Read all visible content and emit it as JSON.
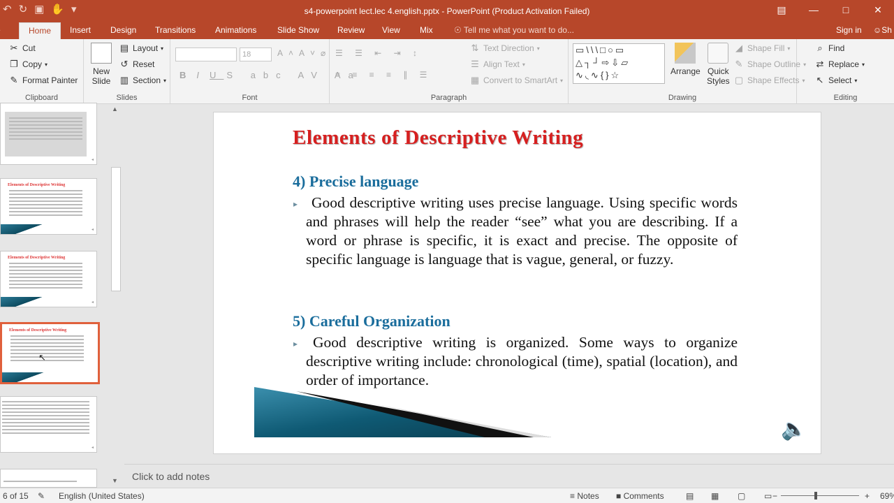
{
  "window": {
    "title": "s4-powerpoint lect.lec 4.english.pptx - PowerPoint (Product Activation Failed)",
    "qat_icons": [
      "undo-icon",
      "redo-icon",
      "present-icon",
      "touch-mode-icon",
      "customize-icon"
    ],
    "controls": [
      "ribbon-display-icon",
      "minimize-icon",
      "maximize-icon",
      "close-icon"
    ]
  },
  "tabs": [
    {
      "label": "Home",
      "active": true
    },
    {
      "label": "Insert"
    },
    {
      "label": "Design"
    },
    {
      "label": "Transitions"
    },
    {
      "label": "Animations"
    },
    {
      "label": "Slide Show"
    },
    {
      "label": "Review"
    },
    {
      "label": "View"
    },
    {
      "label": "Mix"
    }
  ],
  "tell_me": "Tell me what you want to do...",
  "sign_in": "Sign in",
  "share": "Sh",
  "ribbon": {
    "clipboard": {
      "label": "Clipboard",
      "cut": "Cut",
      "copy": "Copy",
      "format_painter": "Format Painter"
    },
    "slides": {
      "label": "Slides",
      "new_slide_1": "New",
      "new_slide_2": "Slide",
      "layout": "Layout",
      "reset": "Reset",
      "section": "Section"
    },
    "font": {
      "label": "Font",
      "font_name": "",
      "font_size": "18"
    },
    "paragraph": {
      "label": "Paragraph",
      "text_direction": "Text Direction",
      "align_text": "Align Text",
      "convert_smartart": "Convert to SmartArt"
    },
    "drawing": {
      "label": "Drawing",
      "arrange": "Arrange",
      "quick_styles_1": "Quick",
      "quick_styles_2": "Styles",
      "shape_fill": "Shape Fill",
      "shape_outline": "Shape Outline",
      "shape_effects": "Shape Effects"
    },
    "editing": {
      "label": "Editing",
      "find": "Find",
      "replace": "Replace",
      "select": "Select"
    }
  },
  "slide": {
    "title": "Elements of Descriptive Writing",
    "section4_heading": "4) Precise language",
    "section4_text": "Good descriptive writing uses precise language. Using specific words and phrases will help the reader “see” what you are describing. If a word or phrase is specific, it is exact and precise. The opposite of specific language is language that is vague, general, or fuzzy.",
    "section5_heading": "5) Careful Organization",
    "section5_text": "Good descriptive writing is organized. Some ways to organize descriptive writing include: chronological (time), spatial (location), and order  of importance."
  },
  "thumbnails": [
    {
      "title": ""
    },
    {
      "title": "Elements of Descriptive Writing"
    },
    {
      "title": "Elements of Descriptive Writing"
    },
    {
      "title": "Elements of Descriptive Writing",
      "selected": true
    },
    {
      "title": ""
    },
    {
      "title": ""
    }
  ],
  "notes_placeholder": "Click to add notes",
  "status": {
    "slide_counter": "6 of 15",
    "language": "English (United States)",
    "notes": "Notes",
    "comments": "Comments",
    "zoom": "69%"
  },
  "colors": {
    "accent": "#b7472a",
    "slide_title": "#d71f1f",
    "slide_heading": "#1a6d9c",
    "selected_thumb_border": "#e0603c"
  }
}
